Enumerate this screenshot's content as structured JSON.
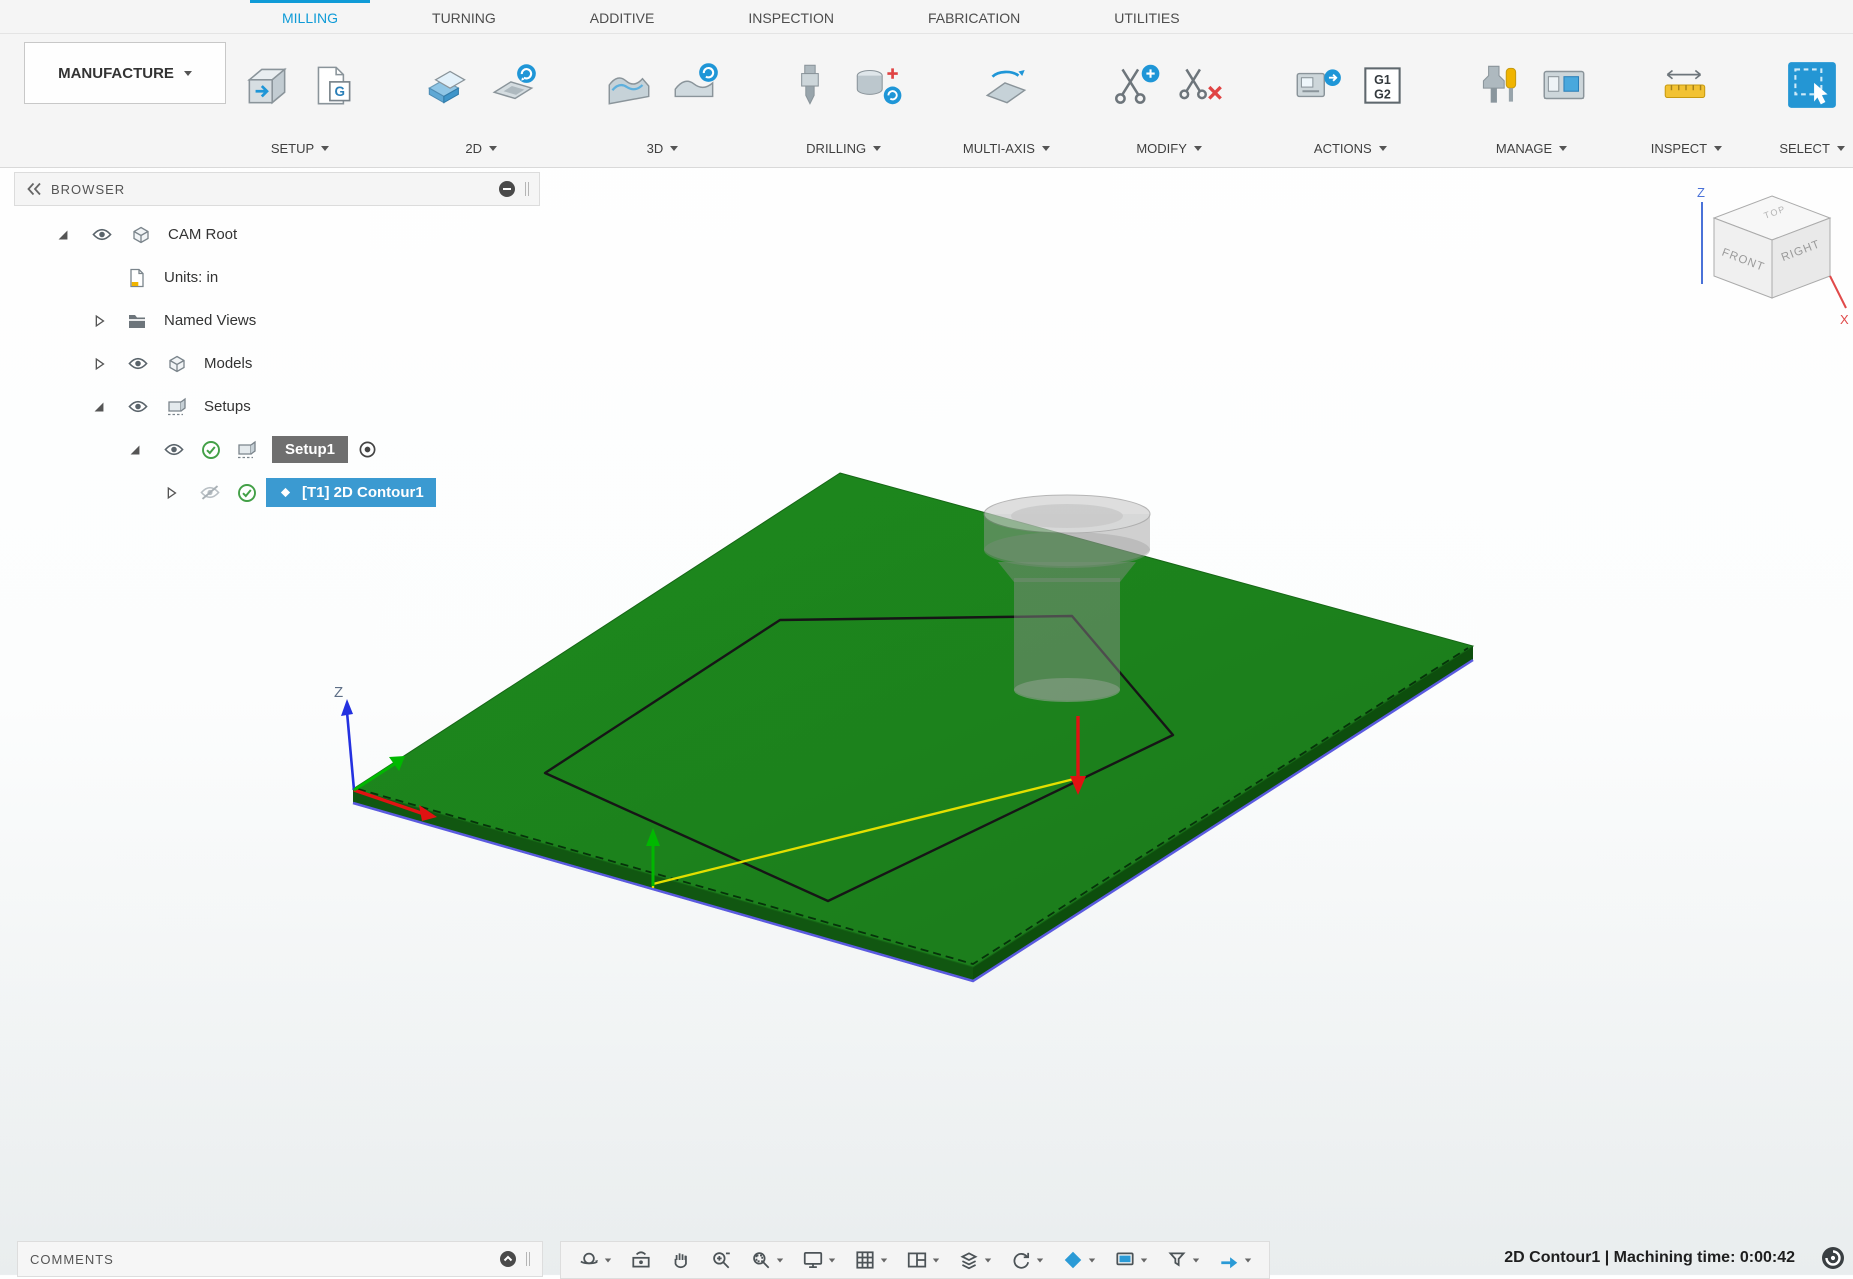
{
  "workspace": {
    "label": "MANUFACTURE"
  },
  "ribbon": {
    "tabs": [
      {
        "label": "MILLING",
        "active": true
      },
      {
        "label": "TURNING",
        "active": false
      },
      {
        "label": "ADDITIVE",
        "active": false
      },
      {
        "label": "INSPECTION",
        "active": false
      },
      {
        "label": "FABRICATION",
        "active": false
      },
      {
        "label": "UTILITIES",
        "active": false
      }
    ],
    "groups": [
      {
        "label": "SETUP",
        "icons": [
          {
            "name": "new-setup-icon"
          },
          {
            "name": "manual-nc-icon",
            "text": "G"
          }
        ]
      },
      {
        "label": "2D",
        "icons": [
          {
            "name": "2d-pocket-icon"
          },
          {
            "name": "2d-contour-icon"
          }
        ]
      },
      {
        "label": "3D",
        "icons": [
          {
            "name": "3d-pocket-icon"
          },
          {
            "name": "3d-contour-icon"
          }
        ]
      },
      {
        "label": "DRILLING",
        "icons": [
          {
            "name": "drill-icon"
          },
          {
            "name": "hole-recognition-icon"
          }
        ]
      },
      {
        "label": "MULTI-AXIS",
        "icons": [
          {
            "name": "multi-axis-icon"
          }
        ]
      },
      {
        "label": "MODIFY",
        "icons": [
          {
            "name": "trim-toolpath-icon"
          },
          {
            "name": "delete-toolpath-icon"
          }
        ]
      },
      {
        "label": "ACTIONS",
        "icons": [
          {
            "name": "post-process-icon"
          },
          {
            "name": "nc-program-icon",
            "text": "G1 G2"
          }
        ]
      },
      {
        "label": "MANAGE",
        "icons": [
          {
            "name": "tool-library-icon"
          },
          {
            "name": "machine-library-icon"
          }
        ]
      },
      {
        "label": "INSPECT",
        "icons": [
          {
            "name": "measure-icon"
          }
        ]
      },
      {
        "label": "SELECT",
        "icons": [
          {
            "name": "select-icon"
          }
        ]
      }
    ]
  },
  "browser": {
    "title": "BROWSER",
    "tree": [
      {
        "label": "CAM Root",
        "indent": 0,
        "expander": "open",
        "eye": "on",
        "check": false,
        "icon": "component",
        "highlight": null,
        "target": false
      },
      {
        "label": "Units: in",
        "indent": 1,
        "expander": null,
        "eye": null,
        "check": false,
        "icon": "document",
        "highlight": null,
        "target": false
      },
      {
        "label": "Named Views",
        "indent": 1,
        "expander": "closed",
        "eye": null,
        "check": false,
        "icon": "folder",
        "highlight": null,
        "target": false
      },
      {
        "label": "Models",
        "indent": 1,
        "expander": "closed",
        "eye": "on",
        "check": false,
        "icon": "component",
        "highlight": null,
        "target": false
      },
      {
        "label": "Setups",
        "indent": 1,
        "expander": "open",
        "eye": "on",
        "check": false,
        "icon": "setups",
        "highlight": null,
        "target": false
      },
      {
        "label": "Setup1",
        "indent": 2,
        "expander": "open",
        "eye": "on",
        "check": true,
        "icon": "setup",
        "highlight": "gray",
        "target": true
      },
      {
        "label": "[T1] 2D Contour1",
        "indent": 3,
        "expander": "closed",
        "eye": "off",
        "check": true,
        "icon": "toolpath",
        "highlight": "blue",
        "target": false
      }
    ]
  },
  "viewcube": {
    "front": "FRONT",
    "right": "RIGHT",
    "top": "TOP",
    "axis_z": "Z",
    "axis_x": "X"
  },
  "viewport": {
    "origin_axis_label": "Z"
  },
  "comments": {
    "title": "COMMENTS"
  },
  "navbar": {
    "items": [
      {
        "name": "orbit-icon",
        "caret": true
      },
      {
        "name": "look-at-icon",
        "caret": false
      },
      {
        "name": "pan-icon",
        "caret": false
      },
      {
        "name": "zoom-icon",
        "caret": false
      },
      {
        "name": "fit-icon",
        "caret": true
      },
      {
        "name": "display-settings-icon",
        "caret": true
      },
      {
        "name": "grid-settings-icon",
        "caret": true
      },
      {
        "name": "viewports-icon",
        "caret": true
      },
      {
        "name": "visual-style-icon",
        "caret": true
      },
      {
        "name": "camera-rotate-icon",
        "caret": true
      },
      {
        "name": "appearance-icon",
        "caret": true
      },
      {
        "name": "environment-icon",
        "caret": true
      },
      {
        "name": "effects-icon",
        "caret": true
      },
      {
        "name": "navigation-arrow-icon",
        "caret": true
      }
    ]
  },
  "statusbar": {
    "text": "2D Contour1 | Machining time: 0:00:42"
  },
  "colors": {
    "accent": "#0f9bd7",
    "selection_blue": "#3b9ad1",
    "setup_highlight_gray": "#6f6f6f",
    "stock_green": "#1d8a1d",
    "toolpath_black": "#161616",
    "lead_yellow": "#e3df00",
    "plunge_red": "#e01212",
    "retract_green": "#00b800"
  }
}
